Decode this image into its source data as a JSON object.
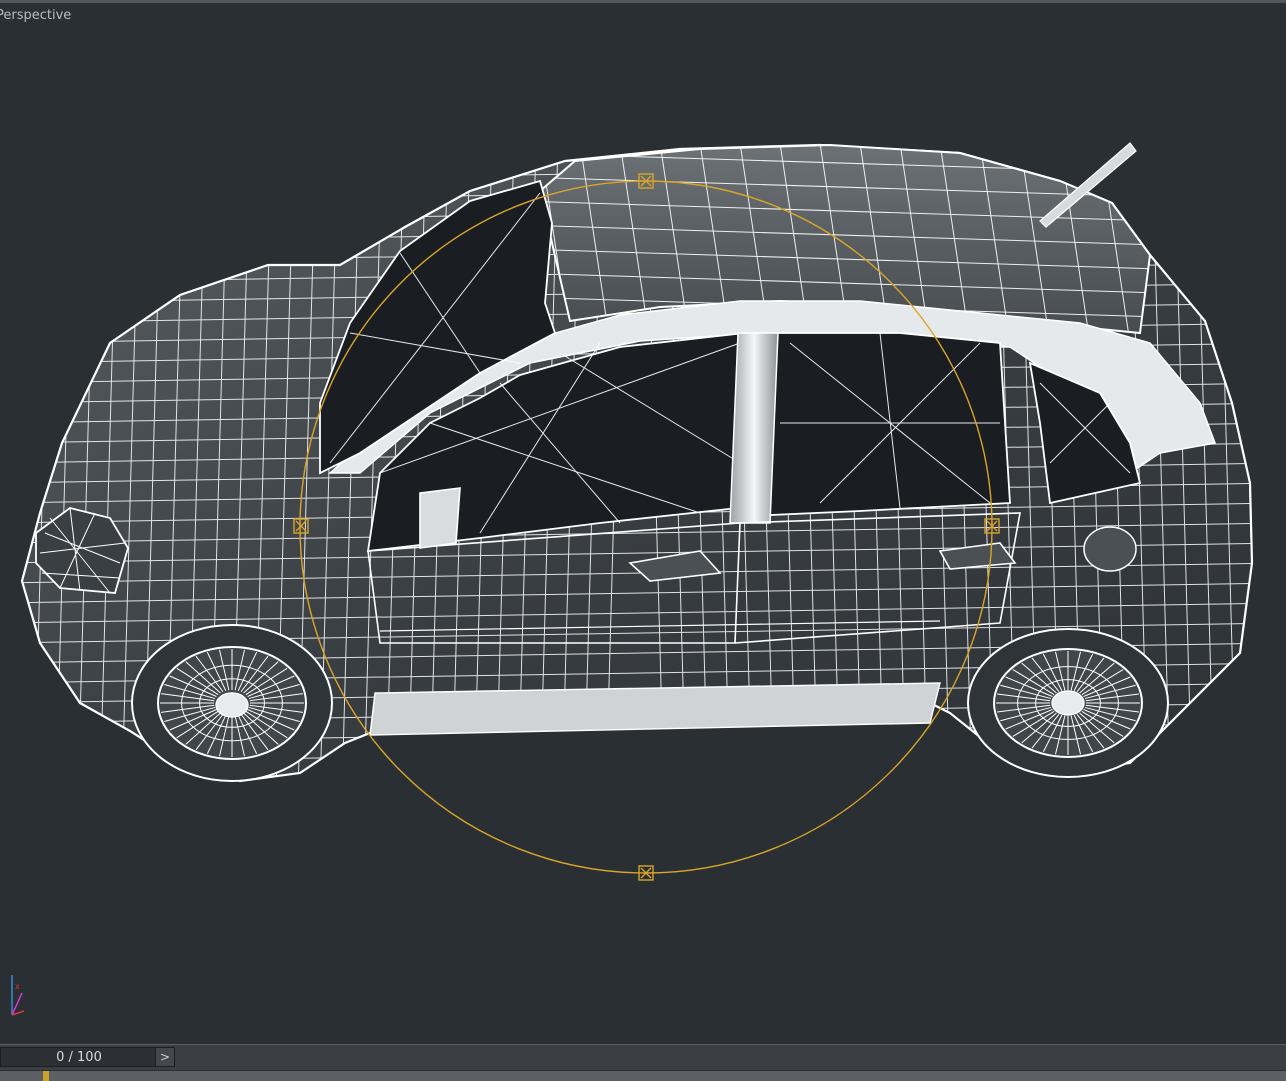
{
  "viewport": {
    "label": "Perspective",
    "wire_color": "#ffffff",
    "gizmo_color": "#d9a52a",
    "background": "#2a2f33"
  },
  "axis_gizmo": {
    "icon": "axis-tripod-icon",
    "x_color": "#d83a3a",
    "y_color": "#3a8ad8",
    "z_color": "#d83ad8"
  },
  "timeline": {
    "frame_counter": "0 / 100",
    "next_label": ">",
    "current_frame": 0,
    "total_frames": 100,
    "marker_color": "#c9a227"
  }
}
